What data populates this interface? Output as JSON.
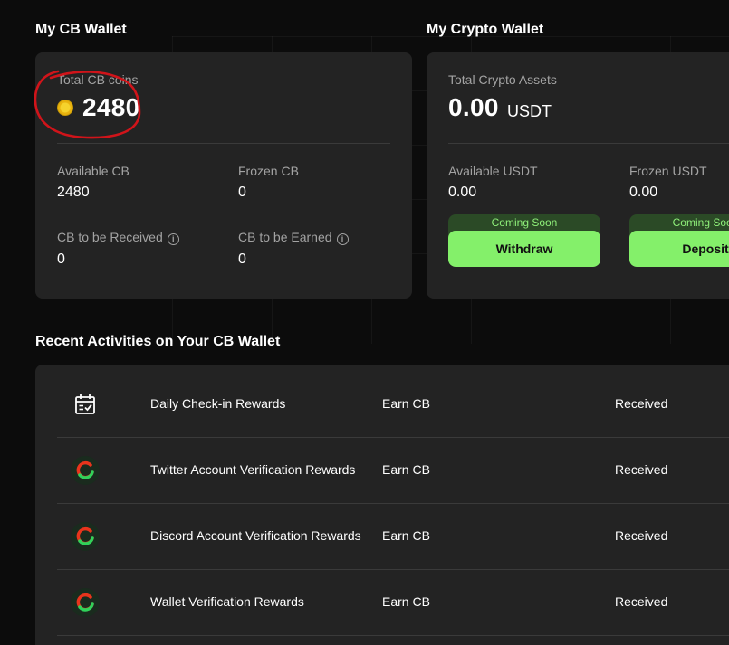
{
  "cb_wallet": {
    "title": "My CB Wallet",
    "total_label": "Total CB coins",
    "total_value": "2480",
    "available_label": "Available CB",
    "available_value": "2480",
    "frozen_label": "Frozen CB",
    "frozen_value": "0",
    "to_receive_label": "CB to be Received",
    "to_receive_value": "0",
    "to_earn_label": "CB to be Earned",
    "to_earn_value": "0"
  },
  "crypto_wallet": {
    "title": "My Crypto Wallet",
    "total_label": "Total Crypto Assets",
    "total_value": "0.00",
    "total_unit": "USDT",
    "available_label": "Available USDT",
    "available_value": "0.00",
    "frozen_label": "Frozen USDT",
    "frozen_value": "0.00",
    "withdraw_badge": "Coming Soon",
    "withdraw_label": "Withdraw",
    "deposit_badge": "Coming Soon",
    "deposit_label": "Deposit"
  },
  "activities": {
    "title": "Recent Activities on Your CB Wallet",
    "rows": [
      {
        "icon": "calendar-check-icon",
        "name": "Daily Check-in Rewards",
        "type": "Earn CB",
        "status": "Received"
      },
      {
        "icon": "cb-logo-icon",
        "name": "Twitter Account Verification Rewards",
        "type": "Earn CB",
        "status": "Received"
      },
      {
        "icon": "cb-logo-icon",
        "name": "Discord Account Verification Rewards",
        "type": "Earn CB",
        "status": "Received"
      },
      {
        "icon": "cb-logo-icon",
        "name": "Wallet Verification Rewards",
        "type": "Earn CB",
        "status": "Received"
      }
    ]
  },
  "colors": {
    "background": "#0c0c0c",
    "card": "#232323",
    "accent_green": "#84f06a",
    "annotation_red": "#d0141a"
  }
}
